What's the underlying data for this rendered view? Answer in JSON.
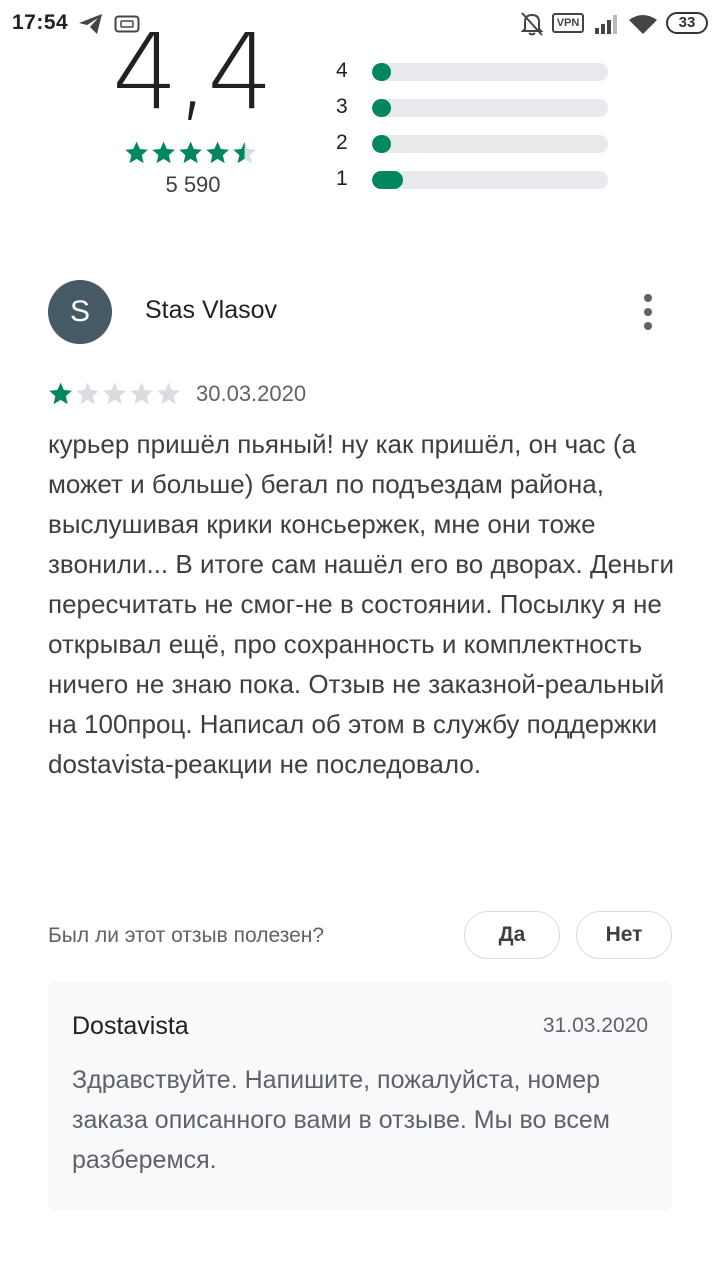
{
  "status_bar": {
    "time": "17:54",
    "vpn": "VPN",
    "battery": "33",
    "icons": [
      "telegram-icon",
      "cast-icon",
      "mute-icon",
      "vpn-icon",
      "signal-icon",
      "wifi-icon",
      "battery-icon"
    ]
  },
  "rating_summary": {
    "average": "4,4",
    "count": "5 590",
    "stars": 4.5,
    "histogram": [
      {
        "label": "4",
        "fraction": 0.05
      },
      {
        "label": "3",
        "fraction": 0.05
      },
      {
        "label": "2",
        "fraction": 0.05
      },
      {
        "label": "1",
        "fraction": 0.13
      }
    ]
  },
  "review": {
    "avatar_letter": "S",
    "author": "Stas Vlasov",
    "rating": 1,
    "date": "30.03.2020",
    "text": "курьер пришёл пьяный! ну как пришёл, он час (а может и больше) бегал по подъездам района, выслушивая крики консьержек, мне они тоже звонили... В итоге сам нашёл его во дворах. Деньги пересчитать не смог-не в состоянии. Посылку я не открывал ещё, про сохранность и комплектность ничего не знаю пока. Отзыв не заказной-реальный на 100проц. Написал об этом в службу поддержки dostavista-реакции не последовало."
  },
  "helpful": {
    "question": "Был ли этот отзыв полезен?",
    "yes_label": "Да",
    "no_label": "Нет"
  },
  "developer_reply": {
    "name": "Dostavista",
    "date": "31.03.2020",
    "text": "Здравствуйте. Напишите, пожалуйста, номер заказа описанного вами в отзыве. Мы во всем разберемся."
  },
  "colors": {
    "accent_green": "#01875f",
    "star_empty": "#dadce0",
    "avatar_bg": "#455a64"
  }
}
